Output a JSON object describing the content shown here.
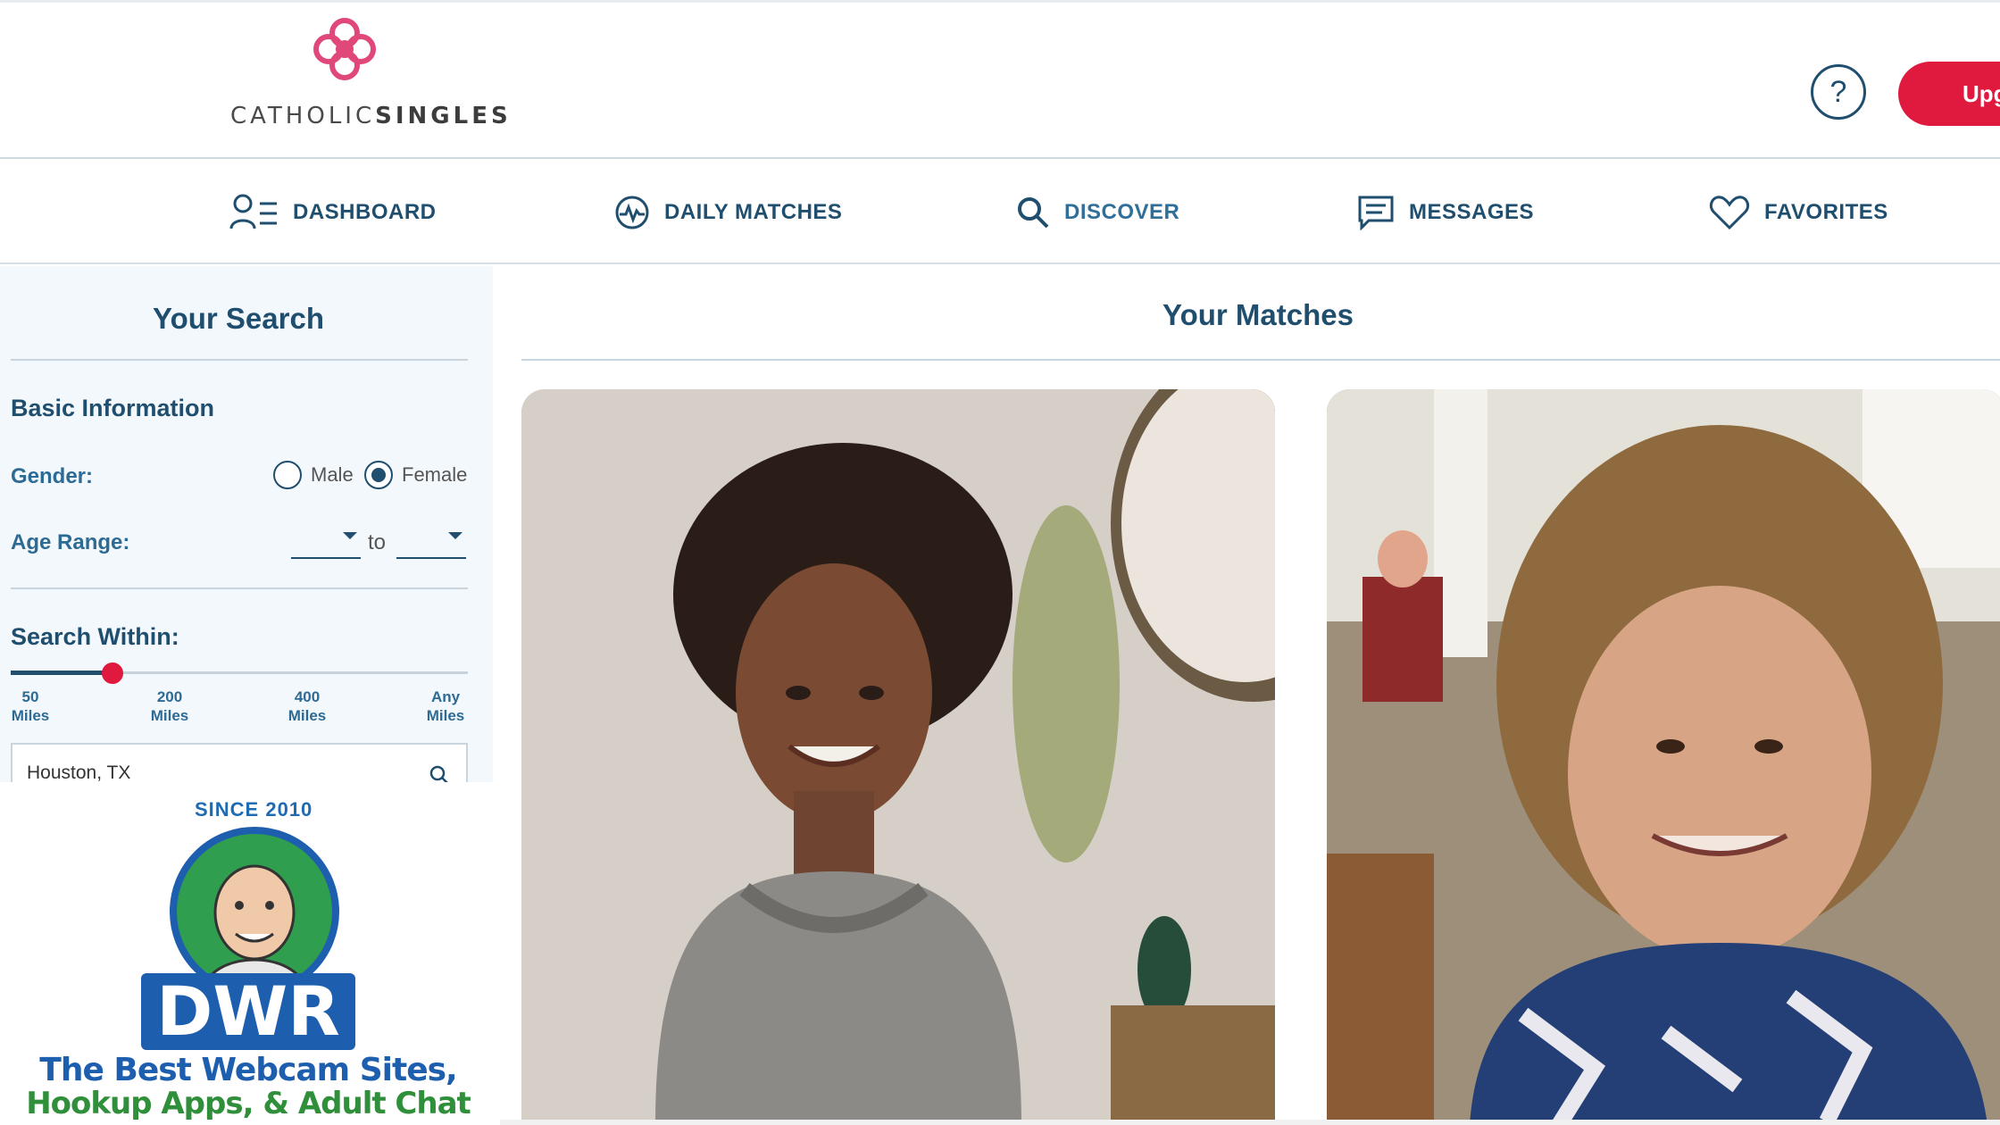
{
  "brand": {
    "name_light": "CATHOLIC",
    "name_bold": "SINGLES",
    "accent_color": "#e0193f",
    "primary_color": "#1f4e6e"
  },
  "header": {
    "help_label": "?",
    "upgrade_label": "Upg"
  },
  "nav": {
    "items": [
      {
        "label": "DASHBOARD",
        "icon": "user-list-icon"
      },
      {
        "label": "DAILY MATCHES",
        "icon": "pulse-heart-icon"
      },
      {
        "label": "DISCOVER",
        "icon": "search-icon"
      },
      {
        "label": "MESSAGES",
        "icon": "chat-icon"
      },
      {
        "label": "FAVORITES",
        "icon": "heart-icon"
      }
    ],
    "active": "DISCOVER"
  },
  "sidebar": {
    "title": "Your Search",
    "basic_info": "Basic Information",
    "gender_label": "Gender:",
    "gender_options": [
      "Male",
      "Female"
    ],
    "gender_selected": "Female",
    "age_label": "Age Range:",
    "age_to": "to",
    "search_within_label": "Search Within:",
    "distance_ticks": [
      {
        "value": "50",
        "unit": "Miles"
      },
      {
        "value": "200",
        "unit": "Miles"
      },
      {
        "value": "400",
        "unit": "Miles"
      },
      {
        "value": "Any",
        "unit": "Miles"
      }
    ],
    "distance_level": 0.22,
    "location_value": "Houston, TX"
  },
  "ad": {
    "since": "SINCE 2010",
    "logo": "DWR",
    "line1": "The Best Webcam Sites,",
    "line2": "Hookup Apps, & Adult Chat Sites!"
  },
  "main": {
    "title": "Your Matches"
  }
}
